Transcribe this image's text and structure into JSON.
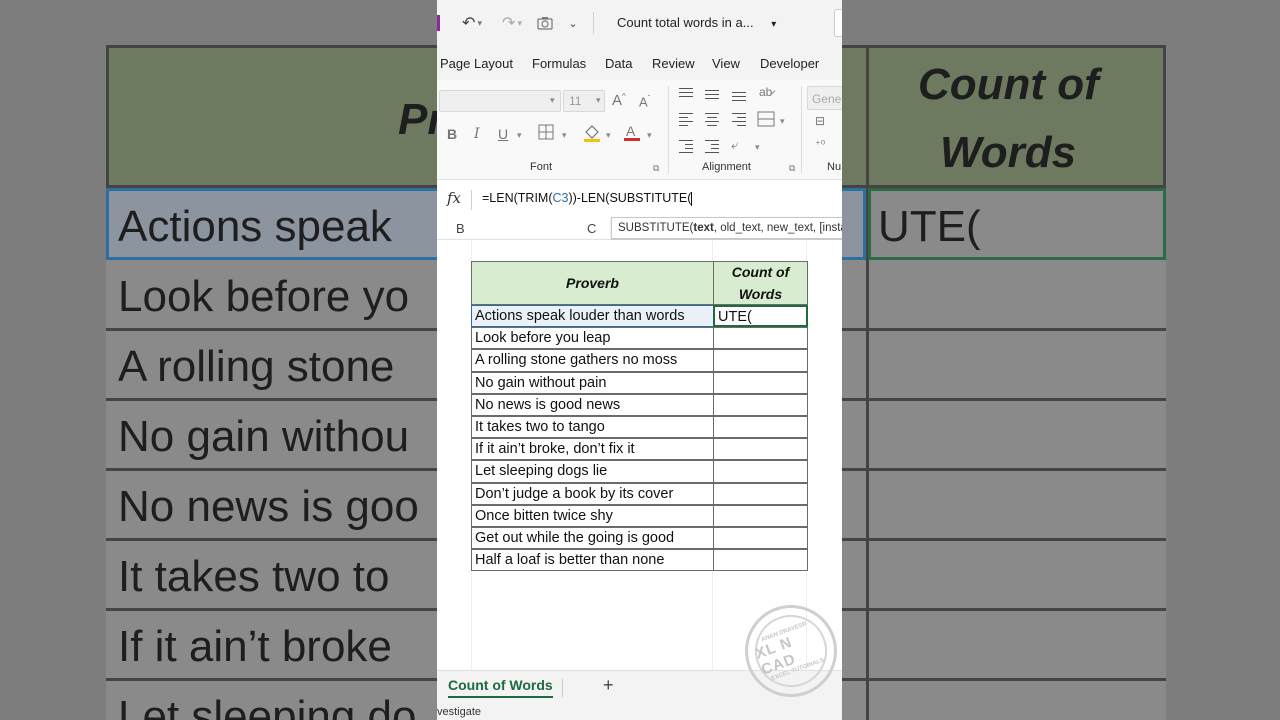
{
  "window": {
    "title": "Count total words in a...",
    "title_dropdown": "▾"
  },
  "ribbon_tabs": [
    "Page Layout",
    "Formulas",
    "Data",
    "Review",
    "View",
    "Developer"
  ],
  "ribbon": {
    "font_size": "11",
    "font_group_label": "Font",
    "alignment_group_label": "Alignment",
    "number_format": "Gener",
    "number_group_label": "Nu",
    "bold": "B",
    "italic": "I",
    "underline": "U"
  },
  "formula_bar": {
    "fx_label": "fx",
    "formula_prefix": "=LEN(TRIM(",
    "formula_ref": "C3",
    "formula_suffix": "))-LEN(SUBSTITUTE("
  },
  "column_headers": [
    "B",
    "C"
  ],
  "tooltip": {
    "func": "SUBSTITUTE(",
    "arg_bold": "text",
    "rest": ", old_text, new_text, [insta"
  },
  "table": {
    "headers": [
      "Proverb",
      "Count of Words"
    ],
    "rows": [
      [
        "Actions speak louder than words",
        "UTE("
      ],
      [
        "Look before you leap",
        ""
      ],
      [
        "A rolling stone gathers no moss",
        ""
      ],
      [
        "No gain without pain",
        ""
      ],
      [
        "No news is good news",
        ""
      ],
      [
        "It takes two to tango",
        ""
      ],
      [
        "If it ain’t broke, don’t fix it",
        ""
      ],
      [
        "Let sleeping dogs lie",
        ""
      ],
      [
        "Don’t judge a book by its cover",
        ""
      ],
      [
        "Once bitten twice shy",
        ""
      ],
      [
        "Get out while the going is good",
        ""
      ],
      [
        "Half a loaf is better than none",
        ""
      ]
    ]
  },
  "sheet_tabs": {
    "active": "Count of Words",
    "add_label": "+"
  },
  "status": {
    "text": "vestigate"
  },
  "background_zoom": {
    "header_left": "Pr",
    "header_right_line1": "Count of",
    "header_right_line2": "Words",
    "rows": [
      "Actions speak",
      "Look before yo",
      "A rolling stone",
      "No gain withou",
      "No news is goo",
      "It takes two to",
      "If it ain’t broke",
      "Let sleeping do"
    ],
    "formula_echo": "UTE("
  },
  "watermark": {
    "main": "XL N CAD",
    "top": "ANAN DRAYESR",
    "bottom": "EXCEL TUTORIALS"
  },
  "colors": {
    "header_fill": "#d8eccf",
    "selection_blue": "#2f6ea0",
    "active_green": "#1e6b3d",
    "accent_purple": "#8a2a9c"
  }
}
